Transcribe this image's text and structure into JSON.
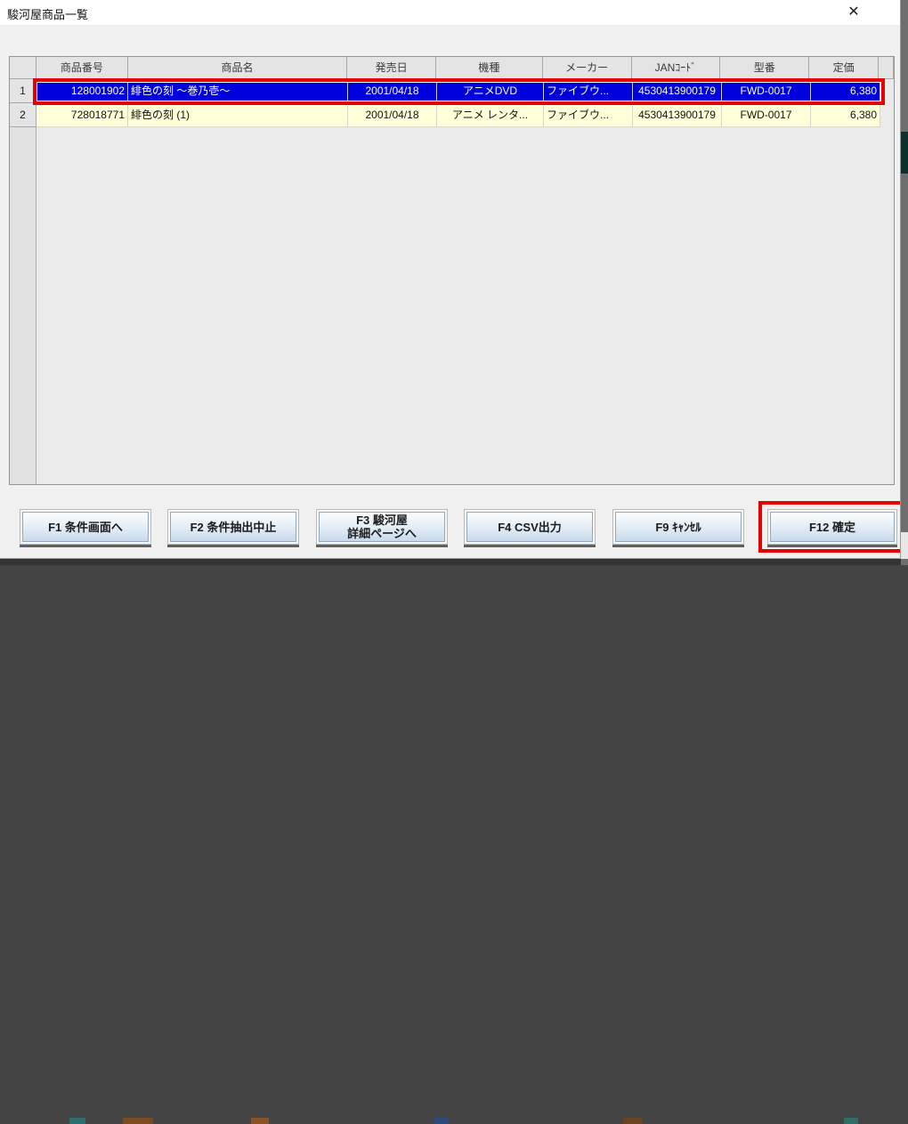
{
  "window": {
    "title": "駿河屋商品一覧",
    "close_icon": "✕"
  },
  "grid": {
    "columns": [
      "商品番号",
      "商品名",
      "発売日",
      "機種",
      "メーカー",
      "JANｺｰﾄﾞ",
      "型番",
      "定価"
    ],
    "rows": [
      {
        "num": "1",
        "product_no": "128001902",
        "product_name": "緋色の刻 〜巻乃壱〜",
        "release_date": "2001/04/18",
        "platform": "アニメDVD",
        "maker": "ファイブウ...",
        "jan_code": "4530413900179",
        "model_no": "FWD-0017",
        "price": "6,380",
        "selected": true
      },
      {
        "num": "2",
        "product_no": "728018771",
        "product_name": "緋色の刻 (1)",
        "release_date": "2001/04/18",
        "platform": "アニメ レンタ...",
        "maker": "ファイブウ...",
        "jan_code": "4530413900179",
        "model_no": "FWD-0017",
        "price": "6,380",
        "selected": false
      }
    ]
  },
  "buttons": {
    "f1": "F1 条件画面へ",
    "f2": "F2 条件抽出中止",
    "f3_line1": "F3 駿河屋",
    "f3_line2": "詳細ページへ",
    "f4": "F4 CSV出力",
    "f9": "F9 ｷｬﾝｾﾙ",
    "f12": "F12 確定"
  },
  "colors": {
    "selected_row_bg": "#0000dd",
    "selected_row_text": "#ffffff",
    "row_bg": "#ffffd9",
    "highlight_border": "#e60000",
    "button_face": "#dce9f4"
  }
}
